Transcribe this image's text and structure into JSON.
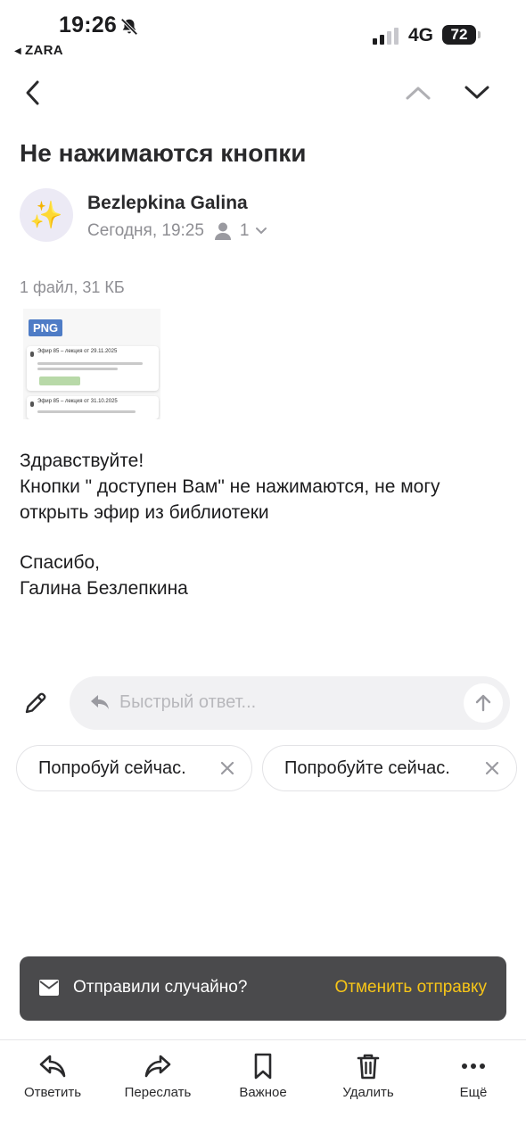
{
  "status_bar": {
    "time": "19:26",
    "back_app": "ZARA",
    "network": "4G",
    "battery": "72"
  },
  "nav": {
    "back_icon": "chevron-left-icon",
    "prev_icon": "chevron-up-icon",
    "next_icon": "chevron-down-icon"
  },
  "email": {
    "subject": "Не нажимаются кнопки",
    "avatar_emoji": "✨",
    "sender": "Bezlepkina Galina",
    "date": "Сегодня, 19:25",
    "recipients_count": "1",
    "attachment_info": "1 файл, 31 КБ",
    "attachment_badge": "PNG",
    "attachment_preview": {
      "item1_title": "Эфир 85 – лекция от 29.11.2025",
      "item2_title": "Эфир 85 – лекция от 31.10.2025"
    },
    "body": {
      "greeting": "Здравствуйте!",
      "line1": "Кнопки \" доступен Вам\" не нажимаются, не могу",
      "line2": "открыть эфир из библиотеки",
      "thanks": "Спасибо,",
      "signature": "Галина Безлепкина"
    }
  },
  "quick_reply": {
    "placeholder": "Быстрый ответ...",
    "suggestions": [
      "Попробуй сейчас.",
      "Попробуйте сейчас."
    ]
  },
  "snackbar": {
    "message": "Отправили случайно?",
    "action": "Отменить отправку",
    "action_color": "#f7c518"
  },
  "bottom_bar": {
    "reply": "Ответить",
    "forward": "Переслать",
    "important": "Важное",
    "delete": "Удалить",
    "more": "Ещё"
  }
}
